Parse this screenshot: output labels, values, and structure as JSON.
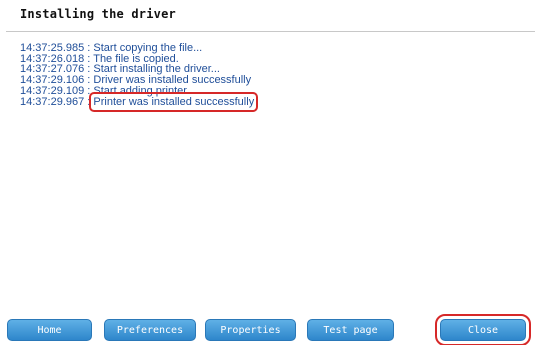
{
  "window": {
    "title": "Installing the driver"
  },
  "log": {
    "lines": [
      {
        "time": "14:37:25.985",
        "sep": " : ",
        "message": "Start copying the file..."
      },
      {
        "time": "14:37:26.018",
        "sep": " : ",
        "message": "The file is copied."
      },
      {
        "time": "14:37:27.076",
        "sep": " : ",
        "message": "Start installing the driver..."
      },
      {
        "time": "14:37:29.106",
        "sep": " : ",
        "message": "Driver was installed successfully"
      },
      {
        "time": "14:37:29.109",
        "sep": " : ",
        "message": "Start adding printer..."
      },
      {
        "time": "14:37:29.967",
        "sep": " : ",
        "message": "Printer was installed successfully"
      }
    ]
  },
  "buttons": {
    "home": "Home",
    "preferences": "Preferences",
    "properties": "Properties",
    "test_page": "Test page",
    "close": "Close"
  },
  "colors": {
    "log_text": "#1f4e99",
    "button": "#3f95d6",
    "highlight": "#d62828"
  }
}
